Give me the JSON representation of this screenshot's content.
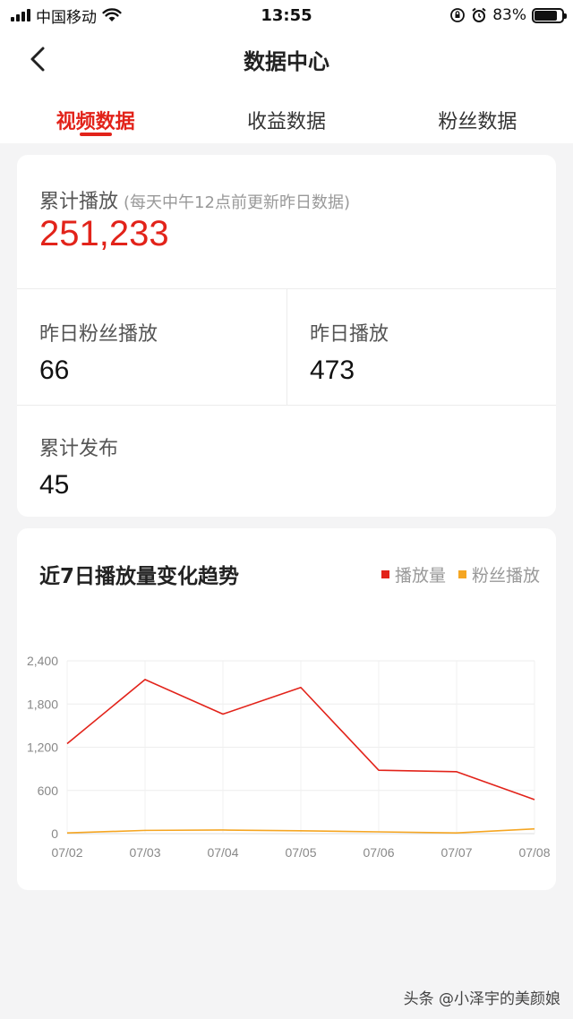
{
  "status_bar": {
    "carrier": "中国移动",
    "time": "13:55",
    "battery": "83%",
    "battery_level": 0.83
  },
  "nav": {
    "title": "数据中心"
  },
  "tabs": [
    {
      "label": "视频数据",
      "active": true
    },
    {
      "label": "收益数据",
      "active": false
    },
    {
      "label": "粉丝数据",
      "active": false
    }
  ],
  "stats": {
    "total_play": {
      "label": "累计播放",
      "note": "(每天中午12点前更新昨日数据)",
      "value": "251,233"
    },
    "yesterday_fan_play": {
      "label": "昨日粉丝播放",
      "value": "66"
    },
    "yesterday_play": {
      "label": "昨日播放",
      "value": "473"
    },
    "total_published": {
      "label": "累计发布",
      "value": "45"
    }
  },
  "chart_card": {
    "title": "近7日播放量变化趋势"
  },
  "chart_data": {
    "type": "line",
    "title": "近7日播放量变化趋势",
    "categories": [
      "07/02",
      "07/03",
      "07/04",
      "07/05",
      "07/06",
      "07/07",
      "07/08"
    ],
    "series": [
      {
        "name": "播放量",
        "color": "#e2231a",
        "values": [
          1250,
          2140,
          1660,
          2030,
          880,
          860,
          473
        ]
      },
      {
        "name": "粉丝播放",
        "color": "#f5a623",
        "values": [
          10,
          45,
          50,
          40,
          25,
          10,
          66
        ]
      }
    ],
    "yticks": [
      0,
      600,
      1200,
      1800,
      2400
    ],
    "ytick_labels": [
      "0",
      "600",
      "1,200",
      "1,800",
      "2,400"
    ],
    "ylim": [
      0,
      2400
    ],
    "grid": true,
    "legend": "top-right"
  },
  "watermark": "头条 @小泽宇的美颜娘"
}
